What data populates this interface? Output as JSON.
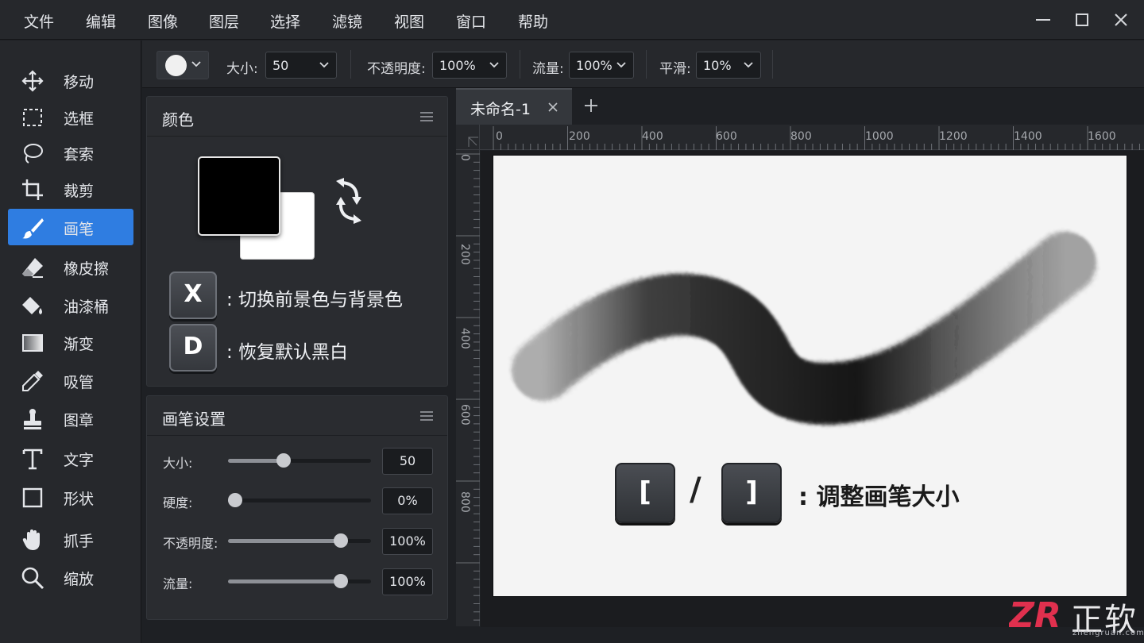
{
  "menu": [
    "文件",
    "编辑",
    "图像",
    "图层",
    "选择",
    "滤镜",
    "视图",
    "窗口",
    "帮助"
  ],
  "tools": [
    {
      "label": "移动",
      "icon": "move-icon",
      "active": false
    },
    {
      "label": "选框",
      "icon": "marquee-icon",
      "active": false
    },
    {
      "label": "套索",
      "icon": "lasso-icon",
      "active": false
    },
    {
      "label": "裁剪",
      "icon": "crop-icon",
      "active": false
    },
    {
      "label": "画笔",
      "icon": "brush-icon",
      "active": true
    },
    {
      "label": "橡皮擦",
      "icon": "eraser-icon",
      "active": false
    },
    {
      "label": "油漆桶",
      "icon": "paint-bucket-icon",
      "active": false
    },
    {
      "label": "渐变",
      "icon": "gradient-icon",
      "active": false
    },
    {
      "label": "吸管",
      "icon": "eyedropper-icon",
      "active": false
    },
    {
      "label": "图章",
      "icon": "stamp-icon",
      "active": false
    },
    {
      "label": "文字",
      "icon": "text-icon",
      "active": false
    },
    {
      "label": "形状",
      "icon": "shape-icon",
      "active": false
    },
    {
      "label": "抓手",
      "icon": "hand-icon",
      "active": false
    },
    {
      "label": "缩放",
      "icon": "zoom-icon",
      "active": false
    }
  ],
  "options": {
    "size_label": "大小:",
    "size_value": "50",
    "opacity_label": "不透明度:",
    "opacity_value": "100%",
    "flow_label": "流量:",
    "flow_value": "100%",
    "smooth_label": "平滑:",
    "smooth_value": "10%"
  },
  "color_panel": {
    "title": "颜色",
    "foreground": "#000000",
    "background": "#ffffff",
    "shortcuts": [
      {
        "key": "X",
        "desc": ": 切换前景色与背景色"
      },
      {
        "key": "D",
        "desc": ": 恢复默认黑白"
      }
    ]
  },
  "brush_panel": {
    "title": "画笔设置",
    "sliders": [
      {
        "label": "大小:",
        "value": "50",
        "fraction": 0.34
      },
      {
        "label": "硬度:",
        "value": "0%",
        "fraction": 0.0
      },
      {
        "label": "不透明度:",
        "value": "100%",
        "fraction": 0.74
      },
      {
        "label": "流量:",
        "value": "100%",
        "fraction": 0.74
      }
    ]
  },
  "document": {
    "tab_label": "未命名-1",
    "ruler_h": [
      "0",
      "200",
      "400",
      "600",
      "800",
      "1000",
      "1200",
      "1400",
      "1600"
    ],
    "ruler_v": [
      "0",
      "200",
      "400",
      "600",
      "800"
    ]
  },
  "canvas_hint": {
    "key_left": "[",
    "slash": "/",
    "key_right": "]",
    "desc": ": 调整画笔大小"
  },
  "watermark": {
    "logo": "ZR",
    "brand": "正软",
    "sub": "zhengruan.com"
  },
  "colors": {
    "accent": "#2f7de1",
    "panel": "#2a2c30",
    "chrome": "#26282c"
  }
}
